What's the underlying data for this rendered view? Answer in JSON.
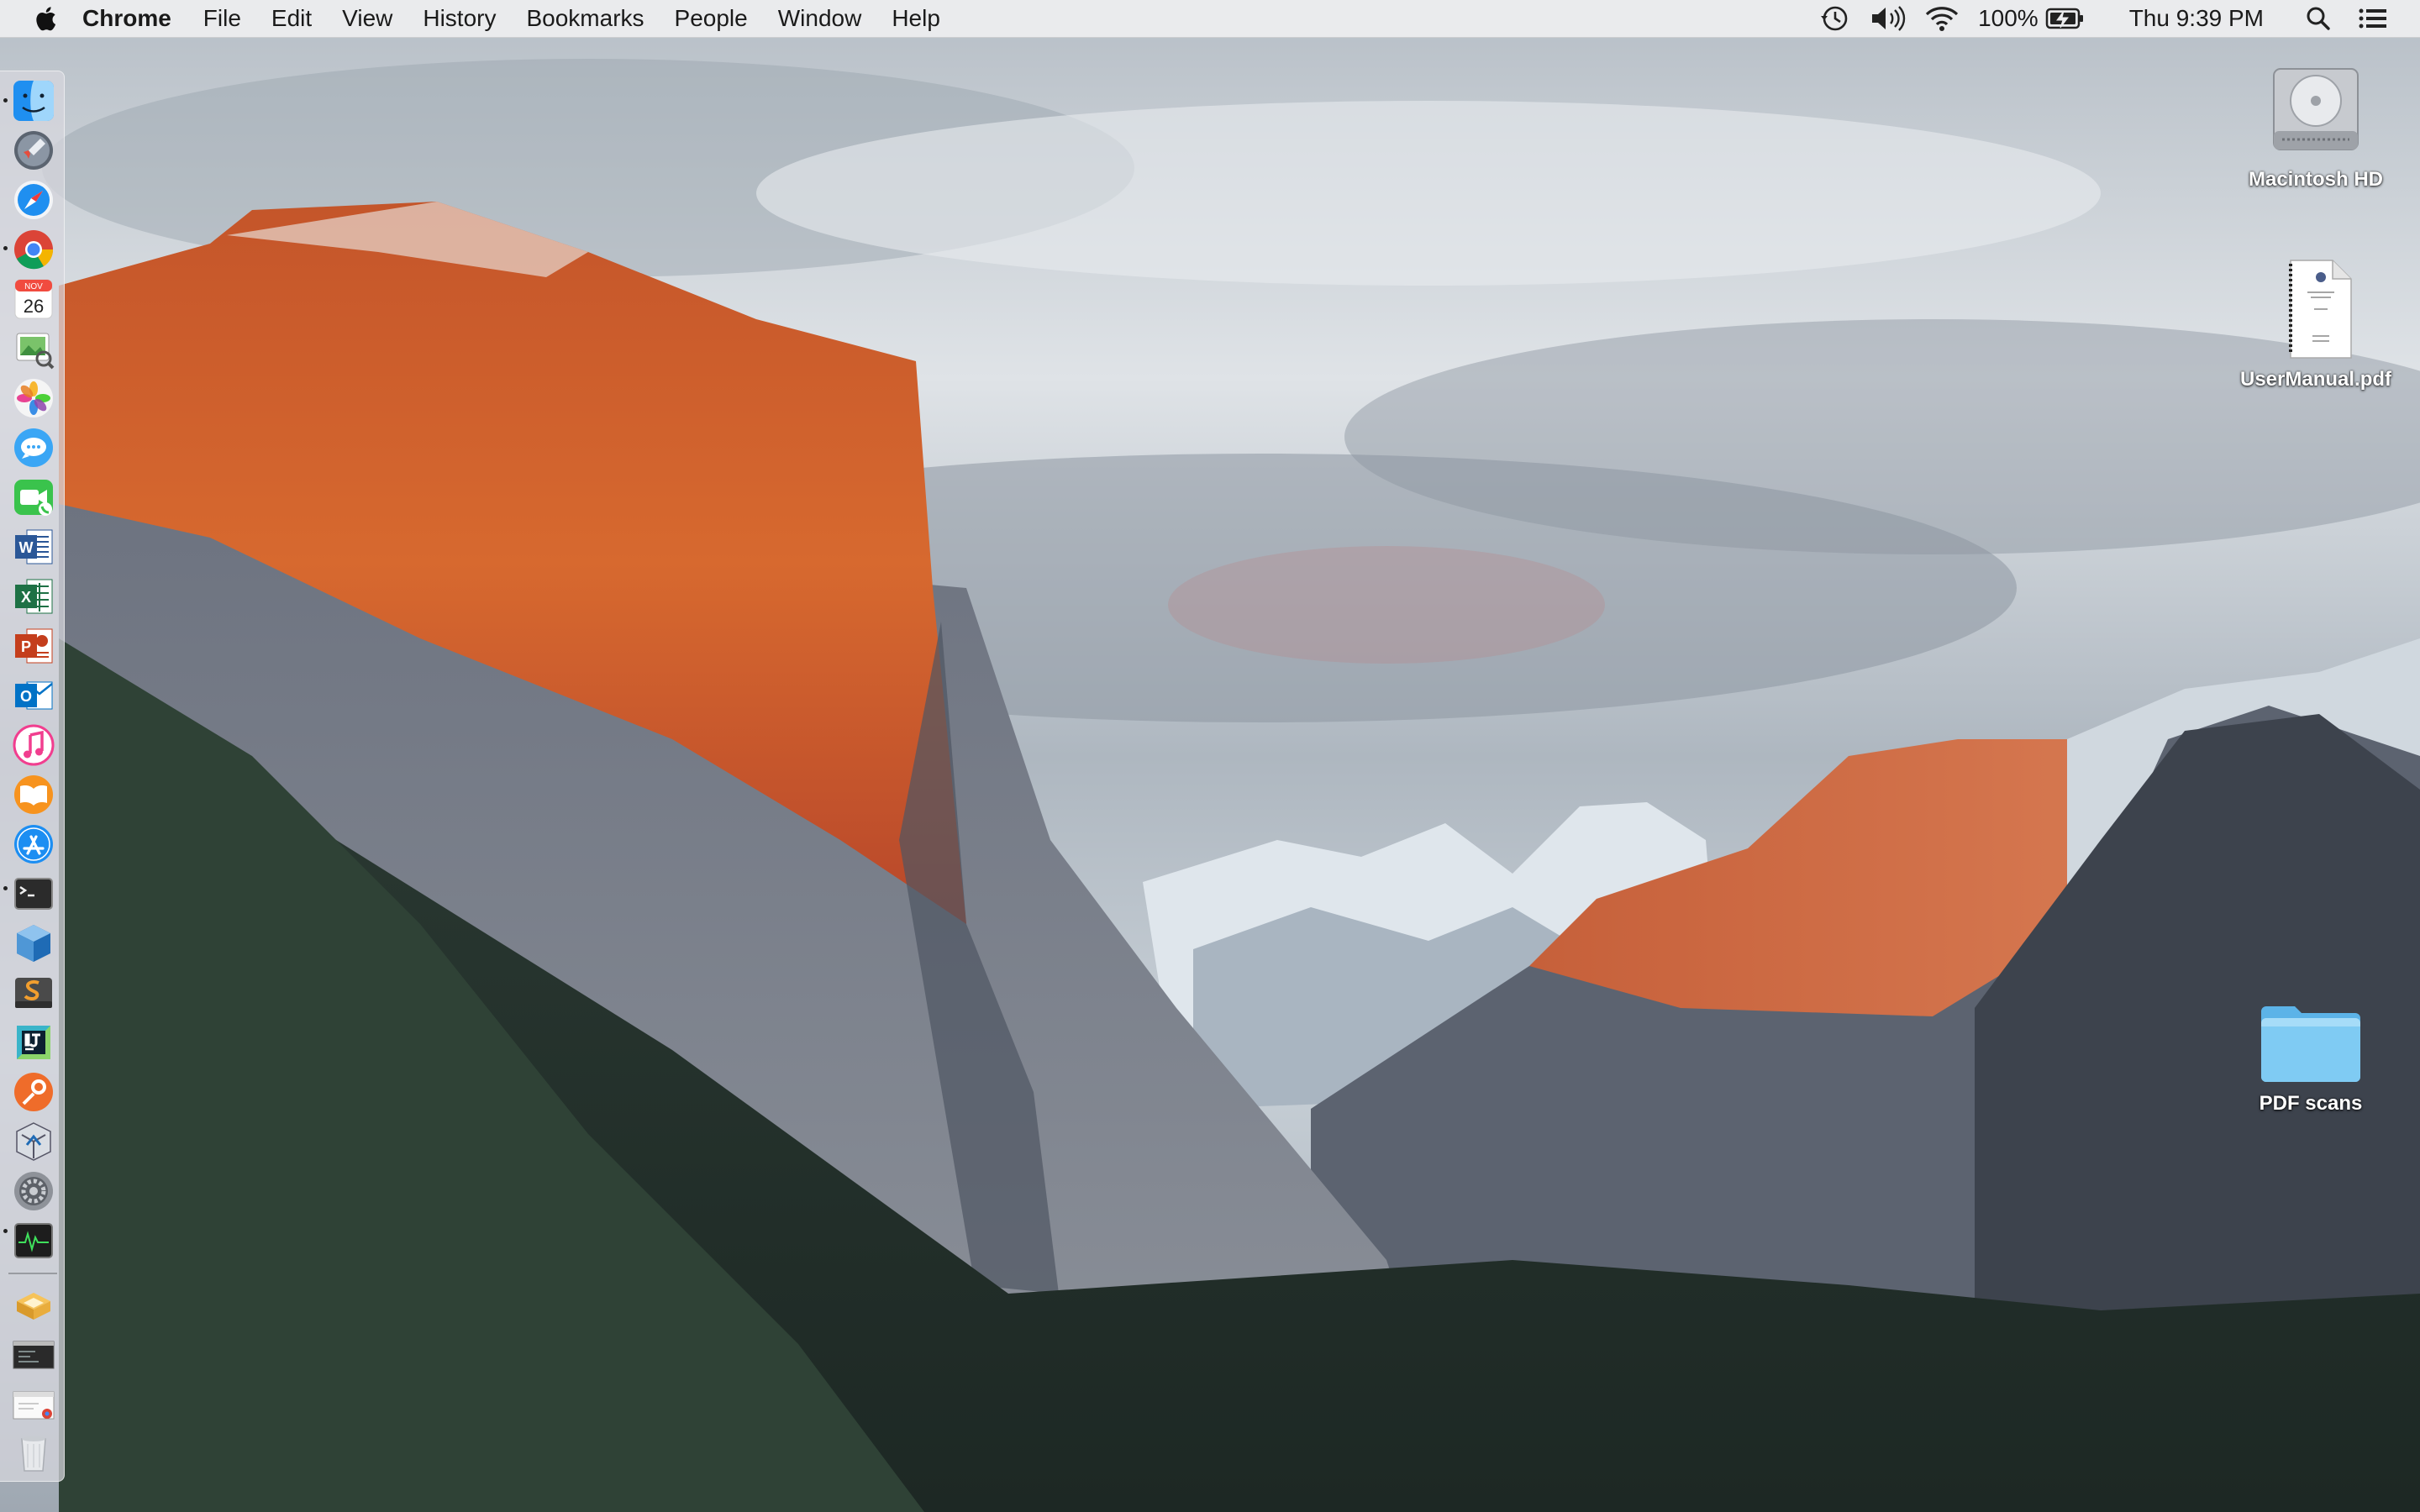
{
  "menubar": {
    "app_name": "Chrome",
    "menus": [
      "File",
      "Edit",
      "View",
      "History",
      "Bookmarks",
      "People",
      "Window",
      "Help"
    ],
    "battery": "100%",
    "clock": "Thu 9:39 PM"
  },
  "status_icons": [
    "time-machine-icon",
    "volume-icon",
    "wifi-icon",
    "battery-charging-icon",
    "spotlight-icon",
    "notification-center-icon"
  ],
  "dock": {
    "apps": [
      {
        "name": "finder-icon",
        "running": true
      },
      {
        "name": "launchpad-icon",
        "running": false
      },
      {
        "name": "safari-icon",
        "running": false
      },
      {
        "name": "chrome-icon",
        "running": true
      },
      {
        "name": "calendar-icon",
        "running": false,
        "month": "NOV",
        "day": "26"
      },
      {
        "name": "preview-icon",
        "running": false
      },
      {
        "name": "photos-icon",
        "running": false
      },
      {
        "name": "messages-icon",
        "running": false
      },
      {
        "name": "facetime-icon",
        "running": false
      },
      {
        "name": "word-icon",
        "running": false,
        "letter": "W"
      },
      {
        "name": "excel-icon",
        "running": false,
        "letter": "X"
      },
      {
        "name": "powerpoint-icon",
        "running": false,
        "letter": "P"
      },
      {
        "name": "outlook-icon",
        "running": false,
        "letter": "O"
      },
      {
        "name": "itunes-icon",
        "running": false
      },
      {
        "name": "ibooks-icon",
        "running": false
      },
      {
        "name": "app-store-icon",
        "running": false
      },
      {
        "name": "terminal-icon",
        "running": true
      },
      {
        "name": "virtualbox-icon",
        "running": false
      },
      {
        "name": "sublime-text-icon",
        "running": false
      },
      {
        "name": "intellij-icon",
        "running": false
      },
      {
        "name": "postman-icon",
        "running": false
      },
      {
        "name": "xcode-instruments-icon",
        "running": false
      },
      {
        "name": "system-preferences-icon",
        "running": false
      },
      {
        "name": "activity-monitor-icon",
        "running": true
      }
    ],
    "stacks": [
      {
        "name": "downloads-stack-icon"
      },
      {
        "name": "terminal-window-stack-icon"
      },
      {
        "name": "document-stack-icon"
      },
      {
        "name": "trash-icon"
      }
    ]
  },
  "desktop": {
    "items": [
      {
        "label": "Macintosh HD",
        "type": "drive"
      },
      {
        "label": "UserManual.pdf",
        "type": "pdf"
      },
      {
        "label": "PDF scans",
        "type": "folder"
      }
    ]
  },
  "colors": {
    "menubar_bg": "#ececee",
    "folder_blue": "#7fcbf3",
    "cliff_orange": "#d2602c",
    "sky_gray": "#c7cfd6"
  }
}
